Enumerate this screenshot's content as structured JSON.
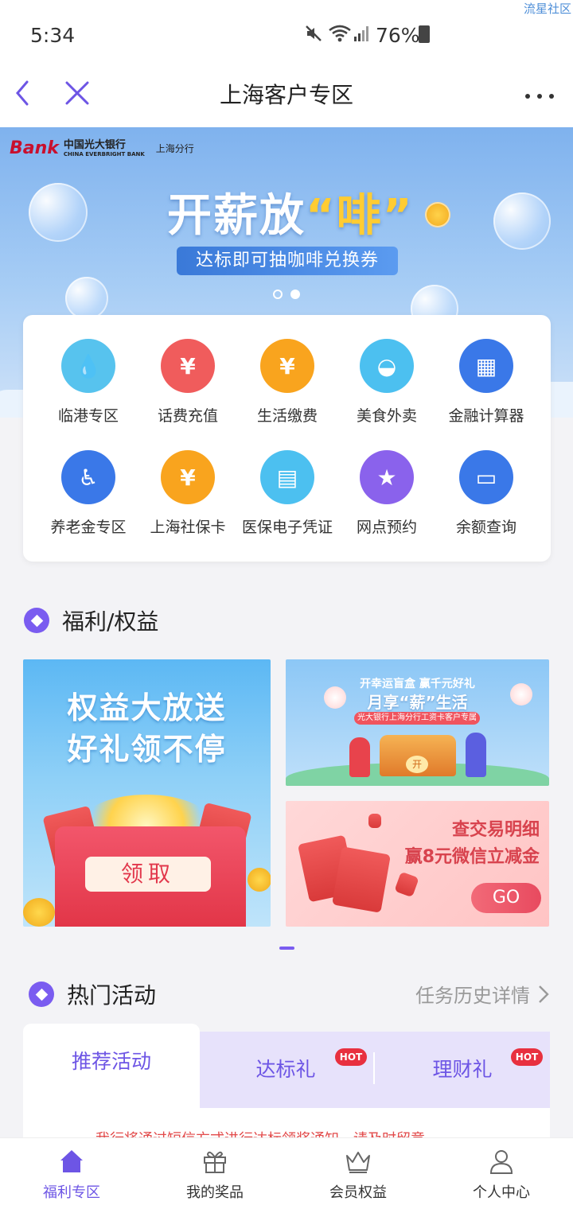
{
  "status": {
    "time": "5:34",
    "battery": "76%",
    "watermark": "流星社区"
  },
  "nav": {
    "title": "上海客户专区",
    "back_icon": "back-chevron-icon",
    "close_icon": "close-icon",
    "more_icon": "more-dots-icon"
  },
  "banner": {
    "bank_mark": "Bank",
    "bank_name_cn": "中国光大银行",
    "bank_name_en": "CHINA EVERBRIGHT BANK",
    "branch": "上海分行",
    "title_main": "开薪放",
    "title_quote": "“啡”",
    "subtitle": "达标即可抽咖啡兑换券",
    "page_count": 2,
    "active_page": 2
  },
  "services": [
    {
      "label": "临港专区",
      "icon": "water-drop-icon",
      "color": "#57c3ee",
      "glyph": "💧"
    },
    {
      "label": "话费充值",
      "icon": "phone-yuan-icon",
      "color": "#f05c5c",
      "glyph": "¥"
    },
    {
      "label": "生活缴费",
      "icon": "wallet-yuan-icon",
      "color": "#f9a41e",
      "glyph": "¥"
    },
    {
      "label": "美食外卖",
      "icon": "food-bowl-icon",
      "color": "#4cc0f0",
      "glyph": "◒"
    },
    {
      "label": "金融计算器",
      "icon": "calculator-icon",
      "color": "#3a78e8",
      "glyph": "▦"
    },
    {
      "label": "养老金专区",
      "icon": "elderly-person-icon",
      "color": "#3a78e8",
      "glyph": "♿"
    },
    {
      "label": "上海社保卡",
      "icon": "shield-yuan-icon",
      "color": "#f9a41e",
      "glyph": "¥"
    },
    {
      "label": "医保电子凭证",
      "icon": "id-card-icon",
      "color": "#4cc0f0",
      "glyph": "▤"
    },
    {
      "label": "网点预约",
      "icon": "booking-icon",
      "color": "#8a62ec",
      "glyph": "★"
    },
    {
      "label": "余额查询",
      "icon": "wallet-icon",
      "color": "#3a78e8",
      "glyph": "▭"
    }
  ],
  "benefits": {
    "section_title": "福利/权益",
    "left_line1": "权益大放送",
    "left_line2": "好礼领不停",
    "left_button": "领取",
    "rt_line1": "开幸运盲盒 赢千元好礼",
    "rt_line2": "月享“薪”生活",
    "rt_line3": "光大银行上海分行工资卡客户专属",
    "rt_chest": "开",
    "rb_line1": "查交易明细",
    "rb_line2": "赢8元微信立减金",
    "rb_button": "GO"
  },
  "activities": {
    "section_title": "热门活动",
    "history_link": "任务历史详情",
    "tabs": [
      {
        "label": "推荐活动",
        "hot": false
      },
      {
        "label": "达标礼",
        "hot": true
      },
      {
        "label": "理财礼",
        "hot": true
      }
    ],
    "hot_badge": "HOT",
    "notice": "我行将通过短信方式进行达标领奖通知，请及时留意"
  },
  "bottom_nav": [
    {
      "label": "福利专区",
      "icon": "home-icon",
      "active": true
    },
    {
      "label": "我的奖品",
      "icon": "gift-icon",
      "active": false
    },
    {
      "label": "会员权益",
      "icon": "crown-icon",
      "active": false
    },
    {
      "label": "个人中心",
      "icon": "person-icon",
      "active": false
    }
  ],
  "colors": {
    "accent": "#6d55e5",
    "tab_bg": "#e7e2fb",
    "hot": "#e8303f"
  }
}
